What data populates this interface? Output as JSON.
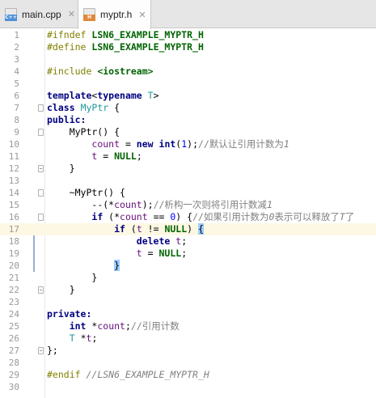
{
  "tabs": [
    {
      "label": "main.cpp",
      "icon": "cpp-file-icon",
      "icon_text": "C++",
      "active": false
    },
    {
      "label": "myptr.h",
      "icon": "header-file-icon",
      "icon_text": "H",
      "active": true
    }
  ],
  "editor": {
    "current_line": 17,
    "lines": [
      {
        "n": "1"
      },
      {
        "n": "2"
      },
      {
        "n": "3"
      },
      {
        "n": "4"
      },
      {
        "n": "5"
      },
      {
        "n": "6"
      },
      {
        "n": "7"
      },
      {
        "n": "8"
      },
      {
        "n": "9"
      },
      {
        "n": "10"
      },
      {
        "n": "11"
      },
      {
        "n": "12"
      },
      {
        "n": "13"
      },
      {
        "n": "14"
      },
      {
        "n": "15"
      },
      {
        "n": "16"
      },
      {
        "n": "17"
      },
      {
        "n": "18"
      },
      {
        "n": "19"
      },
      {
        "n": "20"
      },
      {
        "n": "21"
      },
      {
        "n": "22"
      },
      {
        "n": "23"
      },
      {
        "n": "24"
      },
      {
        "n": "25"
      },
      {
        "n": "26"
      },
      {
        "n": "27"
      },
      {
        "n": "28"
      },
      {
        "n": "29"
      },
      {
        "n": "30"
      }
    ],
    "t": {
      "ifndef": "#ifndef",
      "define": "#define",
      "guard": "LSN6_EXAMPLE_MYPTR_H",
      "include": "#include",
      "iostream": "<iostream>",
      "template": "template",
      "lt": "<",
      "typename": "typename",
      "T": "T",
      "gt_": ">",
      "class": "class",
      "MyPtr": "MyPtr",
      "brace_open_sp": " {",
      "public": "public",
      "colon": ":",
      "ctor": "    MyPtr() {",
      "indent8": "        ",
      "count": "count",
      "eq": " = ",
      "new": "new",
      "sp": " ",
      "int": "int",
      "paren_open": "(",
      "one": "1",
      "paren_close_semi": ");",
      "comment10": "//默认让引用计数为",
      "comment10_it": "1",
      "t": "t",
      "NULL": "NULL",
      "semi": ";",
      "close4": "    }",
      "dtor": "    ~MyPtr() {",
      "dec": "--(*",
      "dec_end": ");",
      "comment15": "//析构一次则将引用计数减",
      "comment15_it": "1",
      "if": "if",
      "if16_a": " (*",
      "if16_b": " == ",
      "zero": "0",
      "if16_c": ") {",
      "comment16": "//如果引用计数为",
      "comment16_it0": "0",
      "comment16_mid": "表示可以释放了",
      "comment16_itT": "T",
      "comment16_end": "了",
      "indent12": "            ",
      "if17_a": " (",
      "if17_b": " != ",
      "if17_c": ") ",
      "lbrace": "{",
      "rbrace": "}",
      "indent16": "                ",
      "delete": "delete",
      "close8_hl_indent": "            ",
      "close8": "        }",
      "private": "private",
      "indent4": "    ",
      "ptr_count": " *",
      "comment25": "//引用计数",
      "T_ptr": "T *",
      "class_end": "};",
      "endif": "#endif",
      "endif_cmt": " //LSN6_EXAMPLE_MYPTR_H"
    }
  }
}
